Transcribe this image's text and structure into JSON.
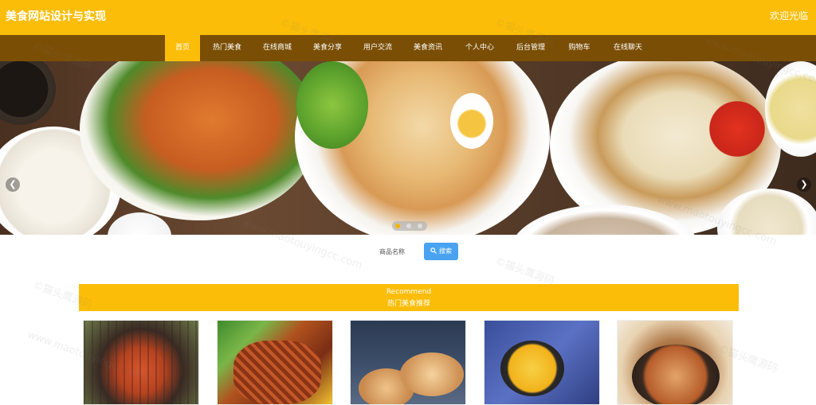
{
  "header": {
    "site_title": "美食网站设计与实现",
    "welcome": "欢迎光临"
  },
  "nav": {
    "items": [
      {
        "label": "首页",
        "active": true
      },
      {
        "label": "热门美食"
      },
      {
        "label": "在线商城"
      },
      {
        "label": "美食分享"
      },
      {
        "label": "用户交流"
      },
      {
        "label": "美食资讯"
      },
      {
        "label": "个人中心"
      },
      {
        "label": "后台管理"
      },
      {
        "label": "购物车"
      },
      {
        "label": "在线聊天"
      }
    ]
  },
  "banner": {
    "prev_icon": "chevron-left-icon",
    "next_icon": "chevron-right-icon",
    "dot_count": 3,
    "active_dot": 1
  },
  "search": {
    "label": "商品名称",
    "button_label": "搜索",
    "button_icon": "search-icon"
  },
  "recommend": {
    "title_en": "Recommend",
    "title_cn": "热门美食推荐"
  },
  "watermark": {
    "text": "©猫头鹰源码",
    "url": "www.maotouyingcc.com"
  },
  "colors": {
    "primary": "#fbbd08",
    "nav": "#7a4e05",
    "search_button": "#4aa3f0"
  }
}
